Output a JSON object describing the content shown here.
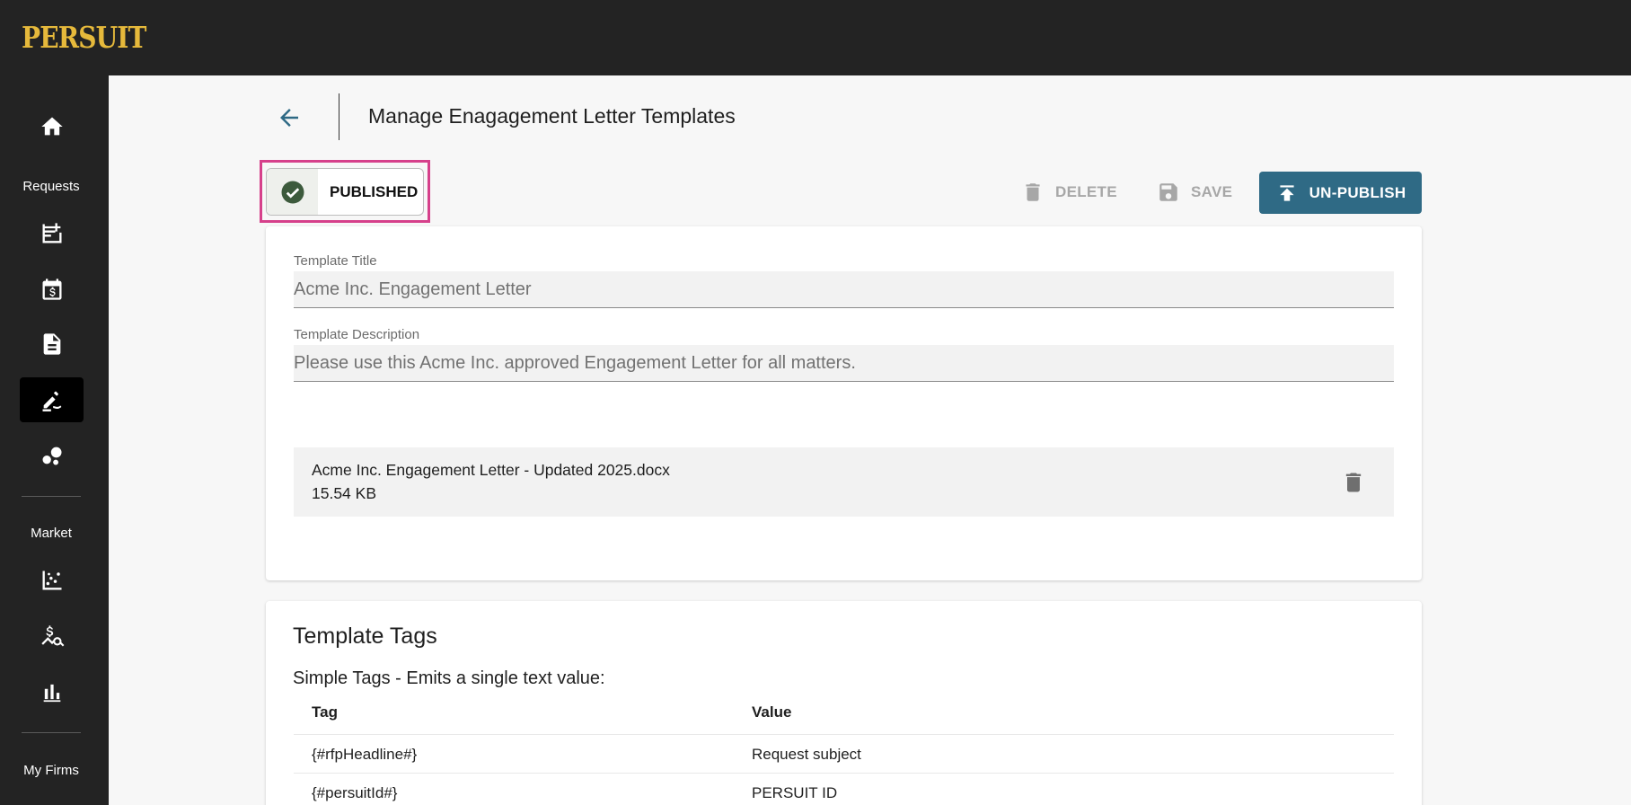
{
  "app": {
    "brand": "PERSUIT"
  },
  "sidebar": {
    "sections": {
      "requests": "Requests",
      "market": "Market",
      "my_firms": "My Firms"
    },
    "items": [
      {
        "name": "home",
        "icon": "home-icon",
        "active": false
      },
      {
        "name": "new-request",
        "icon": "new-request-icon",
        "active": false
      },
      {
        "name": "pricing",
        "icon": "calendar-dollar-icon",
        "active": false
      },
      {
        "name": "documents",
        "icon": "document-icon",
        "active": false
      },
      {
        "name": "engagement-letters",
        "icon": "edit-signature-icon",
        "active": true
      },
      {
        "name": "bubbles",
        "icon": "bubbles-icon",
        "active": false
      },
      {
        "name": "scatter",
        "icon": "scatter-chart-icon",
        "active": false
      },
      {
        "name": "price-search",
        "icon": "price-search-icon",
        "active": false
      },
      {
        "name": "bar-chart",
        "icon": "bar-chart-icon",
        "active": false
      }
    ]
  },
  "header": {
    "title": "Manage Enagagement Letter Templates"
  },
  "status": {
    "label": "PUBLISHED",
    "color": "#3c5a3c"
  },
  "toolbar": {
    "delete_label": "DELETE",
    "save_label": "SAVE",
    "unpublish_label": "UN-PUBLISH",
    "accent": "#2f6a85"
  },
  "form": {
    "title_label": "Template Title",
    "title_value": "Acme Inc. Engagement Letter",
    "description_label": "Template Description",
    "description_value": "Please use this Acme Inc. approved Engagement Letter for all matters."
  },
  "file": {
    "name": "Acme Inc. Engagement Letter - Updated 2025.docx",
    "size": "15.54 KB"
  },
  "tags": {
    "title": "Template Tags",
    "subtitle": "Simple Tags - Emits a single text value:",
    "columns": [
      "Tag",
      "Value"
    ],
    "rows": [
      {
        "tag": "{#rfpHeadline#}",
        "value": "Request subject"
      },
      {
        "tag": "{#persuitId#}",
        "value": "PERSUIT ID"
      }
    ]
  },
  "highlight_color": "#d6408b"
}
